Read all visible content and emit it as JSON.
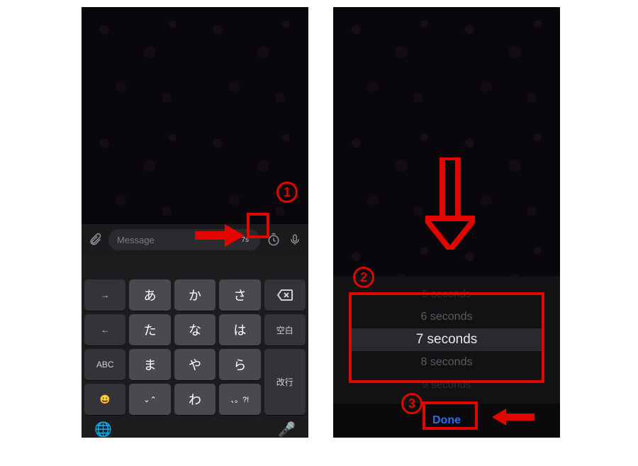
{
  "left": {
    "input": {
      "placeholder": "Message",
      "timer_value": "7s"
    },
    "keyboard": {
      "rows": [
        [
          "→",
          "あ",
          "か",
          "さ",
          "⌫"
        ],
        [
          "←",
          "た",
          "な",
          "は",
          "空白"
        ],
        [
          "ABC",
          "ま",
          "や",
          "ら",
          "改行"
        ],
        [
          "😀",
          "⌄⌃",
          "わ",
          "、。?!",
          ""
        ]
      ],
      "bottom_globe": "🌐",
      "bottom_mic": "🎤"
    }
  },
  "right": {
    "picker": {
      "options": [
        "5 seconds",
        "6 seconds",
        "7 seconds",
        "8 seconds",
        "9 seconds"
      ],
      "selected_index": 2
    },
    "done_label": "Done"
  },
  "annotations": {
    "step1": "1",
    "step2": "2",
    "step3": "3"
  },
  "colors": {
    "annotation_red": "#e10600",
    "done_blue": "#2b6be8"
  }
}
